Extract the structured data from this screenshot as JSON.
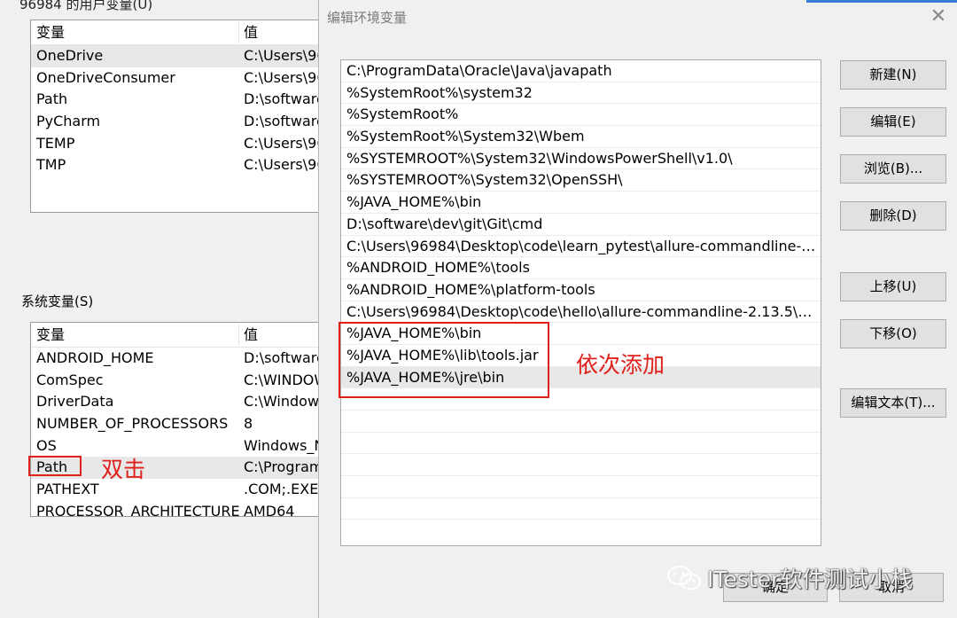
{
  "background_dialog": {
    "title_cut": "96984 的用户变量(U)",
    "user_vars": {
      "headers": [
        "变量",
        "值"
      ],
      "rows": [
        [
          "OneDrive",
          "C:\\Users\\96"
        ],
        [
          "OneDriveConsumer",
          "C:\\Users\\96"
        ],
        [
          "Path",
          "D:\\software"
        ],
        [
          "PyCharm",
          "D:\\software"
        ],
        [
          "TEMP",
          "C:\\Users\\96"
        ],
        [
          "TMP",
          "C:\\Users\\96"
        ]
      ]
    },
    "sys_label": "系统变量(S)",
    "sys_vars": {
      "headers": [
        "变量",
        "值"
      ],
      "rows": [
        [
          "ANDROID_HOME",
          "D:\\software"
        ],
        [
          "ComSpec",
          "C:\\WINDOW"
        ],
        [
          "DriverData",
          "C:\\Window"
        ],
        [
          "NUMBER_OF_PROCESSORS",
          "8"
        ],
        [
          "OS",
          "Windows_N"
        ],
        [
          "Path",
          "C:\\Program"
        ],
        [
          "PATHEXT",
          ".COM;.EXE;"
        ],
        [
          "PROCESSOR_ARCHITECTURE",
          "AMD64"
        ]
      ]
    }
  },
  "annotations": {
    "double_click": "双击",
    "add_in_order": "依次添加"
  },
  "edit_dialog": {
    "title": "编辑环境变量",
    "close_glyph": "✕",
    "paths": [
      "C:\\ProgramData\\Oracle\\Java\\javapath",
      "%SystemRoot%\\system32",
      "%SystemRoot%",
      "%SystemRoot%\\System32\\Wbem",
      "%SYSTEMROOT%\\System32\\WindowsPowerShell\\v1.0\\",
      "%SYSTEMROOT%\\System32\\OpenSSH\\",
      "%JAVA_HOME%\\bin",
      "D:\\software\\dev\\git\\Git\\cmd",
      "C:\\Users\\96984\\Desktop\\code\\learn_pytest\\allure-commandline-2.1...",
      "%ANDROID_HOME%\\tools",
      "%ANDROID_HOME%\\platform-tools",
      "C:\\Users\\96984\\Desktop\\code\\hello\\allure-commandline-2.13.5\\allu...",
      "%JAVA_HOME%\\bin",
      "%JAVA_HOME%\\lib\\tools.jar",
      "%JAVA_HOME%\\jre\\bin"
    ],
    "buttons": {
      "new": "新建(N)",
      "edit": "编辑(E)",
      "browse": "浏览(B)...",
      "delete": "删除(D)",
      "move_up": "上移(U)",
      "move_down": "下移(O)",
      "edit_text": "编辑文本(T)..."
    },
    "ok": "确定",
    "cancel": "取消"
  },
  "watermark": "ITester软件测试小栈",
  "colors": {
    "annotation": "#e0201b",
    "selection": "#e8e8e8",
    "accent": "#3a7bd5"
  }
}
